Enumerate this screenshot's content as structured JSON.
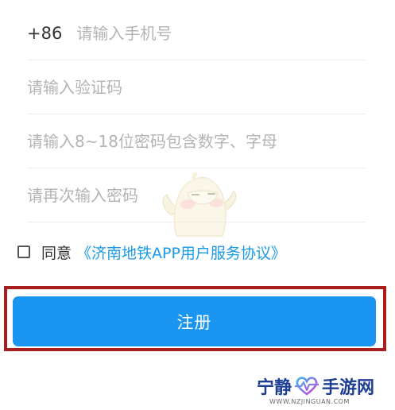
{
  "registration": {
    "phone": {
      "country_code": "+86",
      "placeholder": "请输入手机号"
    },
    "verification_code": {
      "placeholder": "请输入验证码"
    },
    "password": {
      "placeholder": "请输入8~18位密码包含数字、字母"
    },
    "confirm_password": {
      "placeholder": "请再次输入密码"
    },
    "agreement": {
      "checked": false,
      "label": "同意",
      "link_text": "《济南地铁APP用户服务协议》"
    },
    "register_button": {
      "label": "注册"
    }
  },
  "colors": {
    "primary_button": "#1a95f2",
    "link": "#1a9ae8",
    "highlight_frame": "#a81d1d",
    "watermark": "#1e3e96"
  },
  "watermark": {
    "title_left": "宁静",
    "title_right": "手游网",
    "domain": "WWW.NZJINGUAN.COM",
    "logo_icon": "heartbeat-heart-icon"
  },
  "mascot": {
    "icon": "chick-mascot-icon"
  }
}
